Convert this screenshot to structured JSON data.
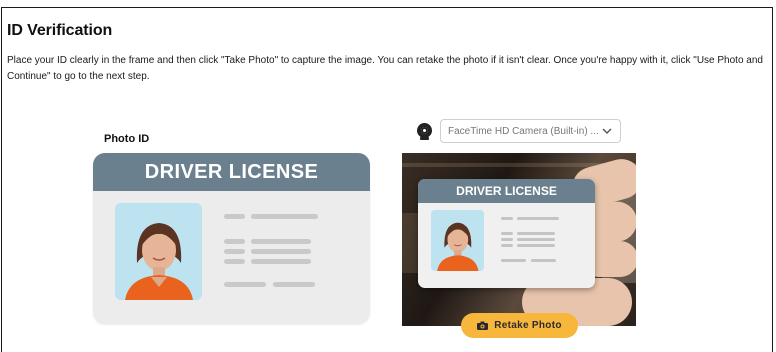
{
  "page": {
    "title": "ID Verification",
    "instructions": "Place your ID clearly in the frame and then click \"Take Photo\" to capture the image. You can retake the photo if it isn't clear. Once you're happy with it, click \"Use Photo and Continue\" to go to the next step."
  },
  "reference": {
    "label": "Photo ID",
    "card_title": "DRIVER LICENSE"
  },
  "camera": {
    "icon": "webcam-icon",
    "selected_device": "FaceTime HD Camera (Built-in) ...",
    "preview_card_title": "DRIVER LICENSE"
  },
  "actions": {
    "retake_label": "Retake Photo",
    "retake_icon": "camera-icon"
  },
  "colors": {
    "card_header": "#6b808e",
    "retake_button": "#f6b73c"
  }
}
